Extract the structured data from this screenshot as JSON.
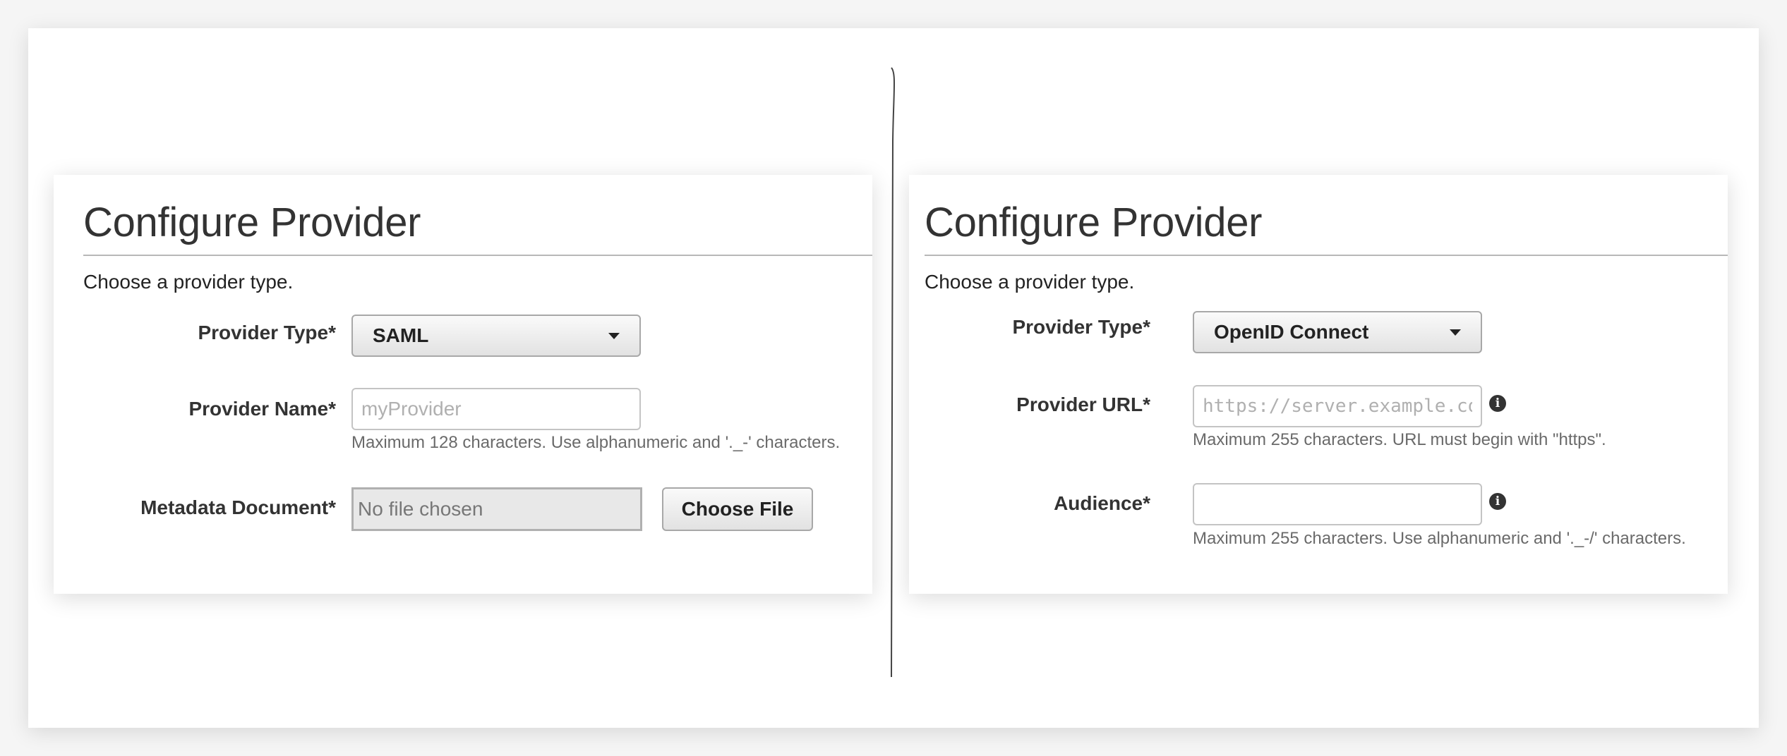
{
  "saml_panel": {
    "title": "Configure Provider",
    "subtitle": "Choose a provider type.",
    "provider_type": {
      "label": "Provider Type*",
      "value": "SAML"
    },
    "provider_name": {
      "label": "Provider Name*",
      "placeholder": "myProvider",
      "value": "",
      "hint": "Maximum 128 characters. Use alphanumeric and '._-' characters."
    },
    "metadata_document": {
      "label": "Metadata Document*",
      "file_status": "No file chosen",
      "button_label": "Choose File"
    }
  },
  "oidc_panel": {
    "title": "Configure Provider",
    "subtitle": "Choose a provider type.",
    "provider_type": {
      "label": "Provider Type*",
      "value": "OpenID Connect"
    },
    "provider_url": {
      "label": "Provider URL*",
      "placeholder": "https://server.example.com",
      "value": "",
      "hint": "Maximum 255 characters. URL must begin with \"https\".",
      "info_icon": "i"
    },
    "audience": {
      "label": "Audience*",
      "placeholder": "",
      "value": "",
      "hint": "Maximum 255 characters. Use alphanumeric and '._-/' characters.",
      "info_icon": "i"
    }
  },
  "icons": {
    "dropdown": "chevron-down-icon",
    "info": "info-icon"
  },
  "colors": {
    "text": "#333333",
    "hint": "#6a6a6a",
    "border": "#a8a8a8"
  }
}
